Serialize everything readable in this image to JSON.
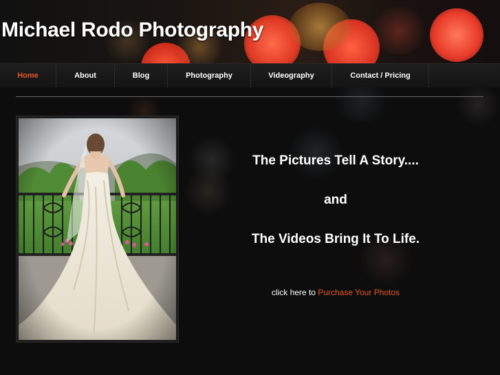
{
  "header": {
    "title": "Michael Rodo Photography"
  },
  "nav": {
    "items": [
      {
        "label": "Home"
      },
      {
        "label": "About"
      },
      {
        "label": "Blog"
      },
      {
        "label": "Photography"
      },
      {
        "label": "Videography"
      },
      {
        "label": "Contact / Pricing"
      }
    ],
    "active_index": 0
  },
  "main": {
    "photo_alt": "Bride in wedding gown on balcony",
    "tagline_1": "The Pictures Tell A Story....",
    "tagline_2": "and",
    "tagline_3": "The Videos Bring It To Life.",
    "cta_prefix": "click here to",
    "cta_link": "Purchase Your Photos"
  },
  "colors": {
    "accent": "#e8572a",
    "background": "#0b0b0b",
    "text": "#ffffff"
  }
}
